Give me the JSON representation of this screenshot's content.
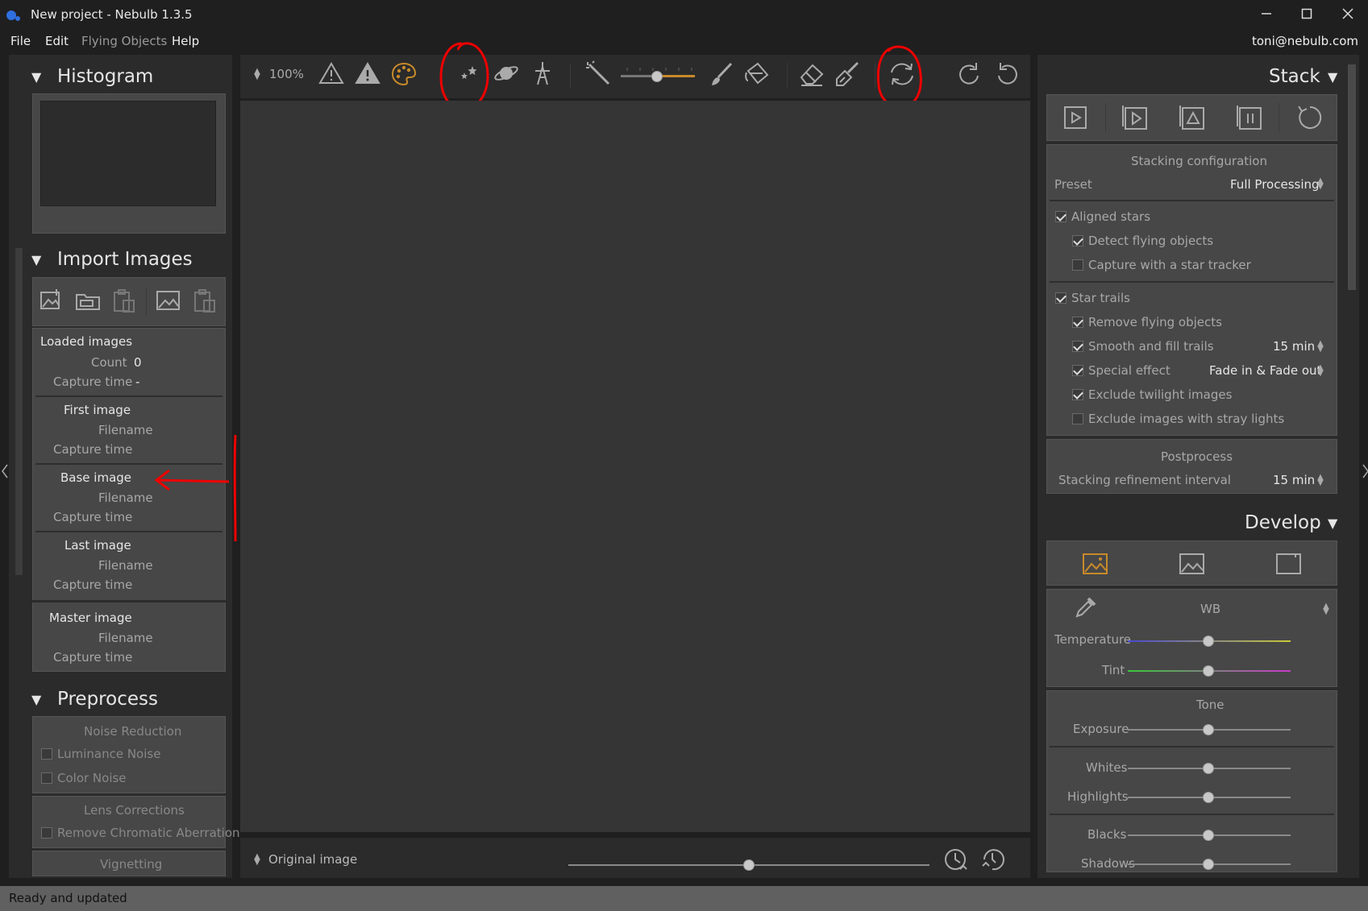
{
  "window": {
    "title": "New project - Nebulb 1.3.5",
    "minimize_icon": "minimize-icon",
    "maximize_icon": "maximize-icon",
    "close_icon": "close-icon",
    "icon": "app-icon",
    "icon_color": "#2f6fe0"
  },
  "menu": {
    "items": [
      "File",
      "Edit",
      "Flying Objects",
      "Help"
    ],
    "user": "toni@nebulb.com"
  },
  "histogram": {
    "title": "Histogram"
  },
  "import_images": {
    "title": "Import Images",
    "icons": [
      "add-images-icon",
      "add-folder-icon",
      "paste-icon",
      "image-icon",
      "clipboard-icon"
    ],
    "loaded_images": {
      "heading": "Loaded images",
      "count_label": "Count",
      "count_value": "0",
      "capture_time_label": "Capture time",
      "capture_time_value": "-"
    },
    "first_image": {
      "heading": "First image",
      "filename_label": "Filename",
      "capture_time_label": "Capture time"
    },
    "base_image": {
      "heading": "Base image",
      "filename_label": "Filename",
      "capture_time_label": "Capture time"
    },
    "last_image": {
      "heading": "Last image",
      "filename_label": "Filename",
      "capture_time_label": "Capture time"
    },
    "master_image": {
      "heading": "Master image",
      "filename_label": "Filename",
      "capture_time_label": "Capture time"
    }
  },
  "preprocess": {
    "title": "Preprocess",
    "noise_reduction": "Noise Reduction",
    "luminance_noise": "Luminance Noise",
    "color_noise": "Color Noise",
    "lens_corrections": "Lens Corrections",
    "remove_ca": "Remove Chromatic Aberration",
    "vignetting": "Vignetting"
  },
  "toolbar": {
    "zoom": "100%",
    "icons": [
      "warning-outline-icon",
      "warning-filled-icon",
      "palette-icon",
      "stars-icon",
      "planet-icon",
      "tower-icon",
      "magic-wand-icon",
      "brush-icon",
      "paint-bucket-icon",
      "eraser-icon",
      "broom-icon",
      "refresh-icon",
      "redo-icon",
      "undo-icon"
    ],
    "accent": "#c88a2a"
  },
  "bottom": {
    "view_label": "Original image",
    "slider_value": 0.5
  },
  "stack": {
    "title": "Stack",
    "icons": [
      "play-icon",
      "play-stack-icon",
      "stack-triangle-icon",
      "stack-pause-icon",
      "reset-icon"
    ],
    "config_title": "Stacking configuration",
    "preset_label": "Preset",
    "preset_value": "Full Processing",
    "aligned_stars": "Aligned stars",
    "detect_flying": "Detect flying objects",
    "star_tracker": "Capture with a star tracker",
    "star_trails": "Star trails",
    "remove_flying": "Remove flying objects",
    "smooth_fill": "Smooth and fill trails",
    "smooth_fill_value": "15 min",
    "special_effect": "Special effect",
    "special_effect_value": "Fade in & Fade out",
    "exclude_twilight": "Exclude twilight images",
    "exclude_stray": "Exclude images with stray lights",
    "postprocess_title": "Postprocess",
    "refinement_label": "Stacking refinement interval",
    "refinement_value": "15 min",
    "checks": {
      "aligned_stars": true,
      "detect_flying": true,
      "star_tracker": false,
      "star_trails": true,
      "remove_flying": true,
      "smooth_fill": true,
      "special_effect": true,
      "exclude_twilight": true,
      "exclude_stray": false
    }
  },
  "develop": {
    "title": "Develop",
    "icons": [
      "develop-image-icon",
      "landscape-icon",
      "crop-frame-icon"
    ],
    "wb_label": "WB",
    "eyedropper_icon": "eyedropper-icon",
    "temperature_label": "Temperature",
    "tint_label": "Tint",
    "tone_label": "Tone",
    "exposure_label": "Exposure",
    "whites_label": "Whites",
    "highlights_label": "Highlights",
    "blacks_label": "Blacks",
    "shadows_label": "Shadows",
    "slider_levels": {
      "temperature": 0.5,
      "tint": 0.5,
      "exposure": 0.5,
      "whites": 0.5,
      "highlights": 0.5,
      "blacks": 0.5,
      "shadows": 0.5
    }
  },
  "status": {
    "text": "Ready and updated"
  },
  "annotation_color": "#e00000"
}
